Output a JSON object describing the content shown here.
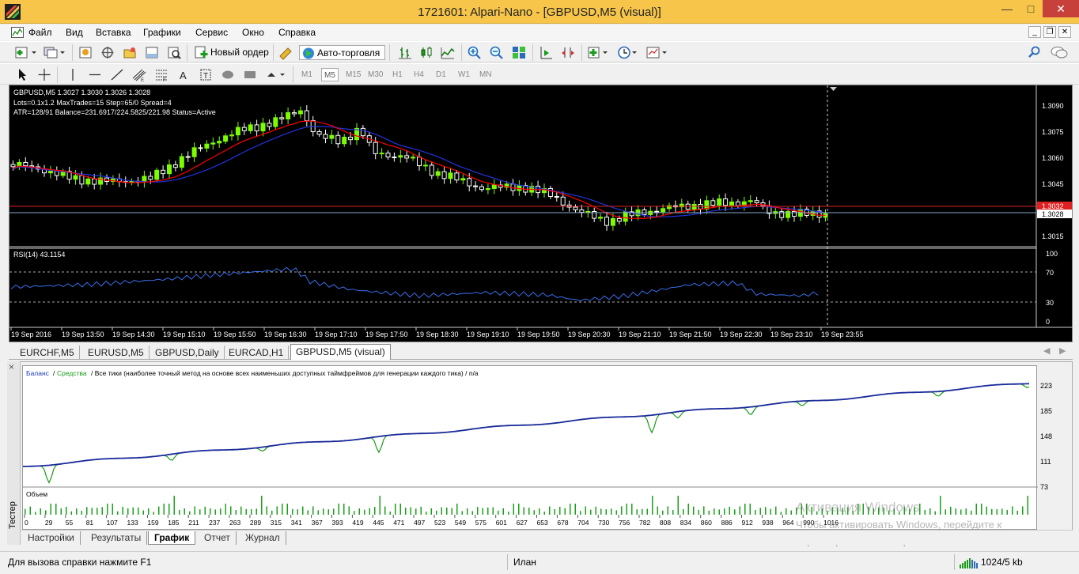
{
  "window": {
    "title": "1721601: Alpari-Nano - [GBPUSD,M5 (visual)]"
  },
  "menu": [
    "Файл",
    "Вид",
    "Вставка",
    "Графики",
    "Сервис",
    "Окно",
    "Справка"
  ],
  "toolbar": {
    "new_order": "Новый ордер",
    "auto_trading": "Авто-торговля"
  },
  "timeframes": [
    "M1",
    "M5",
    "M15",
    "M30",
    "H1",
    "H4",
    "D1",
    "W1",
    "MN"
  ],
  "active_timeframe": "M5",
  "chart": {
    "header": "GBPUSD,M5  1.3027 1.3030 1.3026 1.3028",
    "info1": "Lots=0.1x1.2 MaxTrades=15 Step=65/0 Spread=4",
    "info2": "ATR=128/91 Balance=231.6917/224.5825/221.98 Status=Active",
    "price_ticks": [
      "1.3090",
      "1.3075",
      "1.3060",
      "1.3045",
      "1.3028",
      "1.3015"
    ],
    "red_line_label": "1.3032",
    "current_price": "1.3028",
    "rsi_label": "RSI(14) 43.1154",
    "rsi_ticks": [
      "100",
      "70",
      "30",
      "0"
    ],
    "time_labels": [
      "19 Sep 2016",
      "19 Sep 13:50",
      "19 Sep 14:30",
      "19 Sep 15:10",
      "19 Sep 15:50",
      "19 Sep 16:30",
      "19 Sep 17:10",
      "19 Sep 17:50",
      "19 Sep 18:30",
      "19 Sep 19:10",
      "19 Sep 19:50",
      "19 Sep 20:30",
      "19 Sep 21:10",
      "19 Sep 21:50",
      "19 Sep 22:30",
      "19 Sep 23:10",
      "19 Sep 23:55"
    ],
    "colors": {
      "bull": "#7cfc00",
      "bear": "#ffffff",
      "ma_red": "#ff0000",
      "ma_blue": "#2233dd",
      "rsi": "#3a6ee8"
    }
  },
  "chart_tabs": [
    "EURCHF,M5",
    "EURUSD,M5",
    "GBPUSD,Daily",
    "EURCAD,H1",
    "GBPUSD,M5 (visual)"
  ],
  "active_chart_tab": "GBPUSD,M5 (visual)",
  "tester": {
    "side_label": "Тестер",
    "legend_balance": "Баланс",
    "legend_equity": "Средства",
    "legend_rest": "/ Все тики (наиболее точный метод на основе всех наименьших доступных таймфреймов для генерации каждого тика) / n/a",
    "y_ticks": [
      "223",
      "185",
      "148",
      "111",
      "73"
    ],
    "volume_label": "Объем",
    "x_ticks": [
      "0",
      "29",
      "55",
      "81",
      "107",
      "133",
      "159",
      "185",
      "211",
      "237",
      "263",
      "289",
      "315",
      "341",
      "367",
      "393",
      "419",
      "445",
      "471",
      "497",
      "523",
      "549",
      "575",
      "601",
      "627",
      "653",
      "678",
      "704",
      "730",
      "756",
      "782",
      "808",
      "834",
      "860",
      "886",
      "912",
      "938",
      "964",
      "990",
      "1016"
    ],
    "tabs": [
      "Настройки",
      "Результаты",
      "График",
      "Отчет",
      "Журнал"
    ],
    "active_tab": "График"
  },
  "status": {
    "help": "Для вызова справки нажмите F1",
    "profile": "Илан",
    "traffic": "1024/5 kb"
  },
  "watermark": {
    "line1": "Активация Windows",
    "line2": "Чтобы активировать Windows, перейдите к",
    "line3": "параметрам компьютера."
  }
}
